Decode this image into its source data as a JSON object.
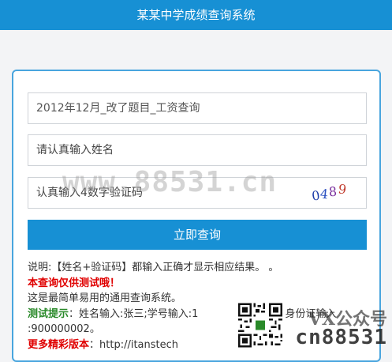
{
  "header": {
    "title": "某某中学成绩查询系统"
  },
  "form": {
    "field1_value": "2012年12月_改了题目_工资查询",
    "field2_placeholder": "请认真输入姓名",
    "field3_placeholder": "认真输入4数字验证码",
    "captcha": [
      "0",
      "4",
      "8",
      "9"
    ],
    "submit_label": "立即查询"
  },
  "info": {
    "line1": "说明:【姓名+验证码】都输入正确才显示相应结果。 。",
    "line2": "本查询仅供测试哦！",
    "line3": "这是最简单易用的通用查询系统。",
    "line4_label": "测试提示",
    "line4_text": "：姓名输入:张三;学号输入:1",
    "line4_tail": "身份证输入",
    "line5": ":900000002。",
    "line6_label": "更多精彩版本",
    "line6_text": "：http://itanstech"
  },
  "watermarks": {
    "center": "www.88531.cn",
    "bottom_right_1": "VX公众号",
    "bottom_right_2": "cn88531"
  }
}
